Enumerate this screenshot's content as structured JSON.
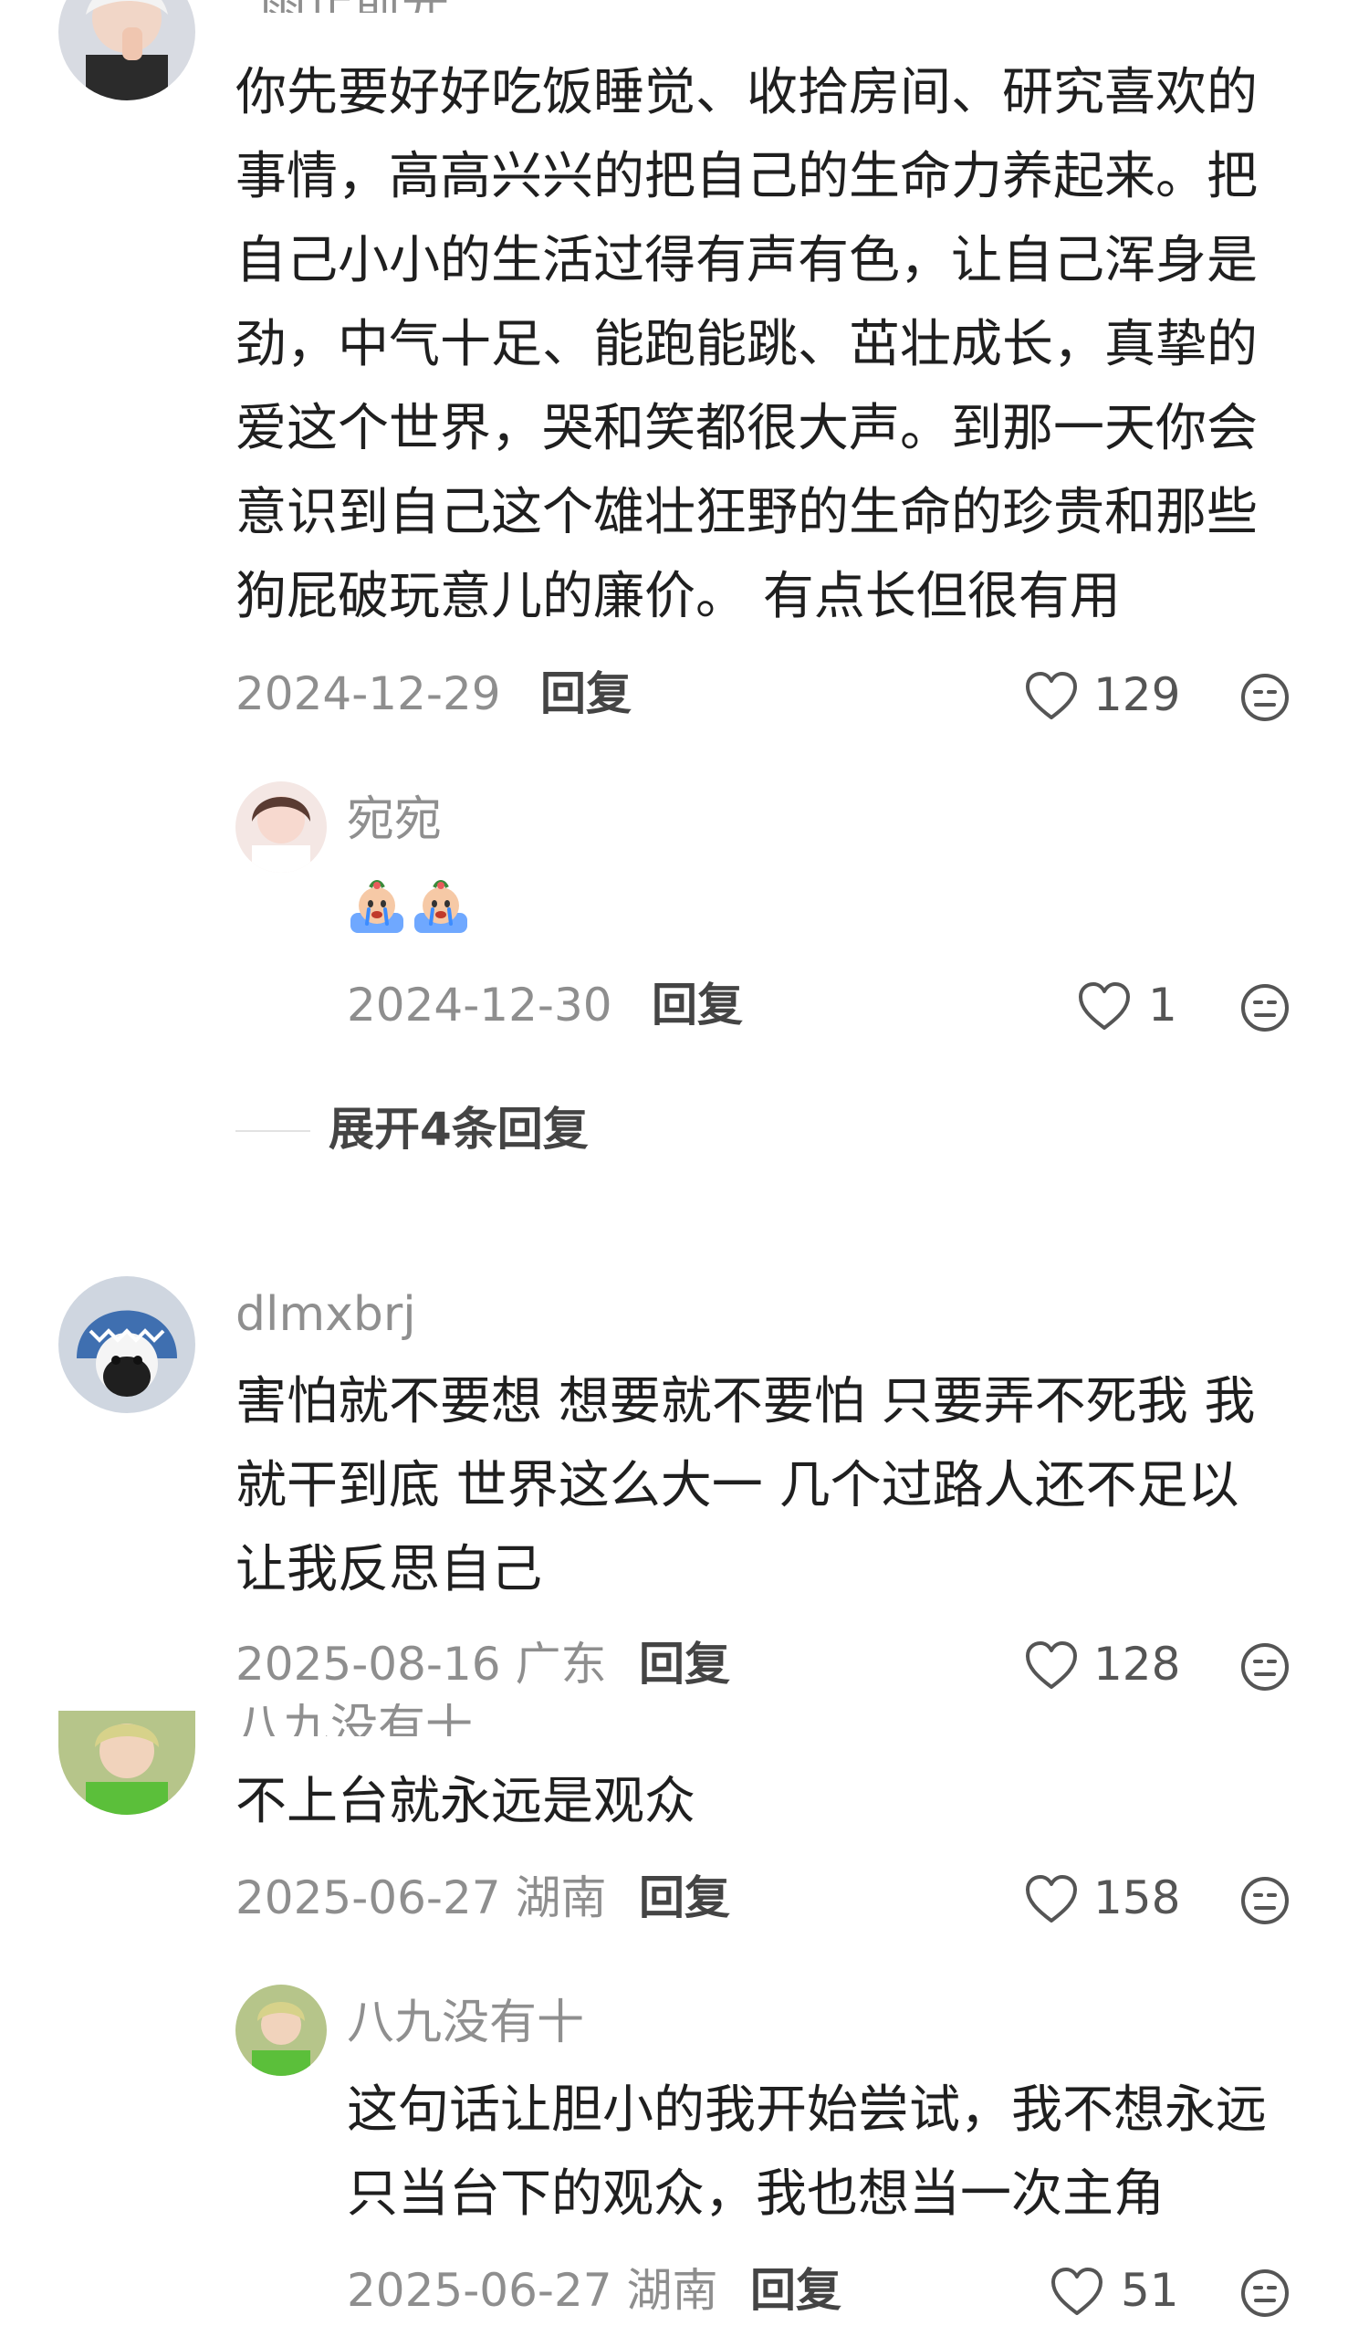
{
  "icons": {
    "like": "heart-outline-icon",
    "more": "emoji-reaction-icon"
  },
  "comments": [
    {
      "username": "_雨止前光",
      "text_lines": [
        "你先要好好吃饭睡觉、收拾房间、研究喜欢的",
        "事情，高高兴兴的把自己的生命力养起来。把",
        "自己小小的生活过得有声有色，让自己浑身是",
        "劲，中气十足、能跑能跳、茁壮成长，真挚的",
        "爱这个世界，哭和笑都很大声。到那一天你会",
        "意识到自己这个雄壮狂野的生命的珍贵和那些",
        "狗屁破玩意儿的廉价。 有点长但很有用"
      ],
      "date": "2024-12-29",
      "reply_label": "回复",
      "likes": "129",
      "replies": [
        {
          "username": "宛宛",
          "emojis": [
            "crying-emoji",
            "crying-emoji"
          ],
          "date": "2024-12-30",
          "reply_label": "回复",
          "likes": "1"
        }
      ],
      "expand_label": "展开4条回复"
    },
    {
      "username": "dlmxbrj",
      "text_lines": [
        "害怕就不要想 想要就不要怕 只要弄不死我 我",
        "就干到底 世界这么大一 几个过路人还不足以",
        "让我反思自己"
      ],
      "date": "2025-08-16 广东",
      "reply_label": "回复",
      "likes": "128"
    },
    {
      "username": "八九没有十",
      "text_lines": [
        "不上台就永远是观众"
      ],
      "date": "2025-06-27 湖南",
      "reply_label": "回复",
      "likes": "158",
      "replies": [
        {
          "username": "八九没有十",
          "text_lines": [
            "这句话让胆小的我开始尝试，我不想永远",
            "只当台下的观众，我也想当一次主角"
          ],
          "date": "2025-06-27 湖南",
          "reply_label": "回复",
          "likes": "51"
        }
      ]
    }
  ]
}
